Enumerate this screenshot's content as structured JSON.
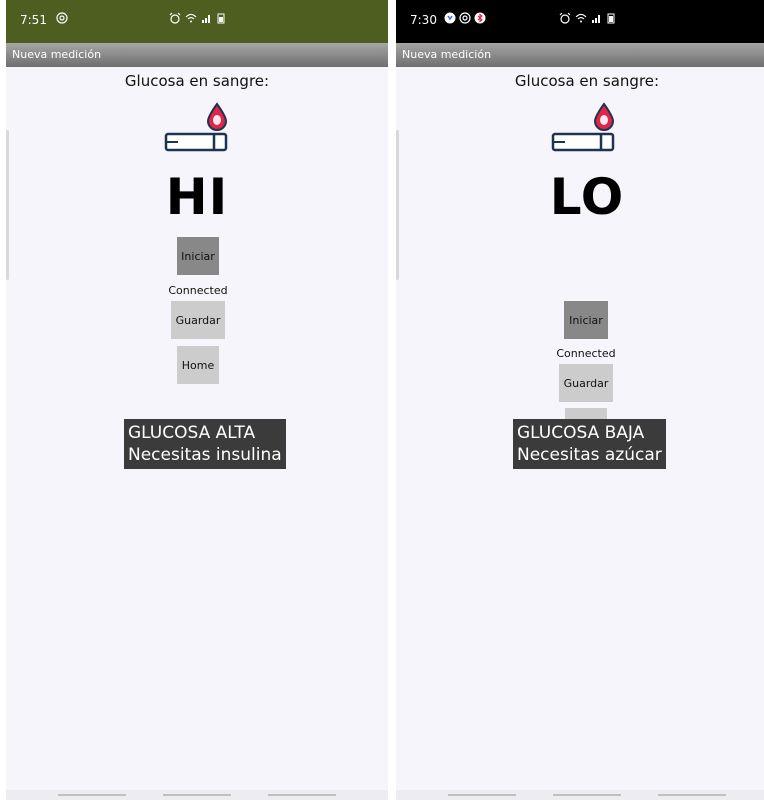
{
  "screens": [
    {
      "statusbar": {
        "time": "7:51",
        "bg": "#4e5d20"
      },
      "appbar": {
        "title": "Nueva medición"
      },
      "title": "Glucosa en sangre:",
      "reading": "HI",
      "buttons": {
        "start": "Iniciar",
        "save": "Guardar",
        "home": "Home"
      },
      "connection_status": "Connected",
      "toast": {
        "line1": "GLUCOSA ALTA",
        "line2": "Necesitas insulina"
      }
    },
    {
      "statusbar": {
        "time": "7:30",
        "bg": "#000000"
      },
      "appbar": {
        "title": "Nueva medición"
      },
      "title": "Glucosa en sangre:",
      "reading": "LO",
      "buttons": {
        "start": "Iniciar",
        "save": "Guardar"
      },
      "connection_status": "Connected",
      "toast": {
        "line1": "GLUCOSA BAJA",
        "line2": "Necesitas azúcar"
      }
    }
  ],
  "colors": {
    "drop": "#e0244a",
    "strip_outline": "#1f3350",
    "toast_bg": "#3b3b3b"
  }
}
